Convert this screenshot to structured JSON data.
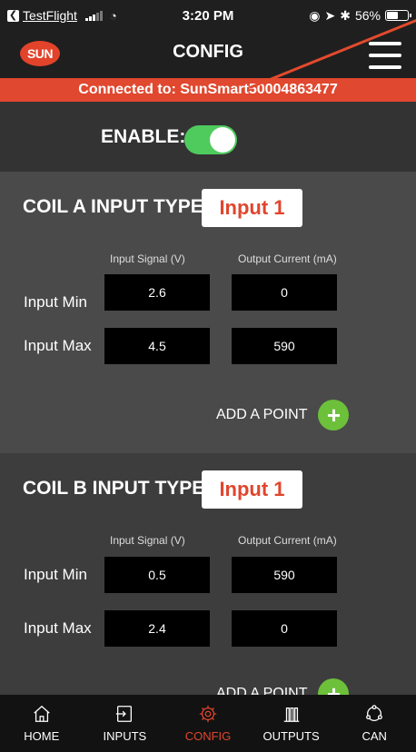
{
  "status_bar": {
    "back_app": "TestFlight",
    "time": "3:20 PM",
    "battery": "56%",
    "battery_level": 0.56
  },
  "header": {
    "logo_text": "SUN",
    "title": "CONFIG",
    "menu_icon": "hamburger-menu-icon"
  },
  "connection": {
    "text": "Connected to: SunSmart50004863477"
  },
  "enable": {
    "label": "ENABLE:",
    "on": true
  },
  "coil_a": {
    "title": "COIL A INPUT TYPE:",
    "type_value": "Input 1",
    "col_signal": "Input Signal (V)",
    "col_current": "Output Current (mA)",
    "rows": [
      {
        "label": "Input Min",
        "signal": "2.6",
        "current": "0"
      },
      {
        "label": "Input Max",
        "signal": "4.5",
        "current": "590"
      }
    ],
    "add_point": "ADD A POINT"
  },
  "coil_b": {
    "title": "COIL B INPUT TYPE:",
    "type_value": "Input 1",
    "col_signal": "Input Signal (V)",
    "col_current": "Output Current (mA)",
    "rows": [
      {
        "label": "Input Min",
        "signal": "0.5",
        "current": "590"
      },
      {
        "label": "Input Max",
        "signal": "2.4",
        "current": "0"
      }
    ],
    "add_point": "ADD A POINT"
  },
  "nav": {
    "items": [
      {
        "label": "HOME",
        "icon": "home-icon"
      },
      {
        "label": "INPUTS",
        "icon": "inputs-icon"
      },
      {
        "label": "CONFIG",
        "icon": "gear-icon",
        "active": true
      },
      {
        "label": "OUTPUTS",
        "icon": "outputs-icon"
      },
      {
        "label": "CAN",
        "icon": "can-icon"
      }
    ]
  },
  "colors": {
    "accent": "#e0482f",
    "toggle_on": "#4fcb5e",
    "add_button": "#6dc03a"
  }
}
